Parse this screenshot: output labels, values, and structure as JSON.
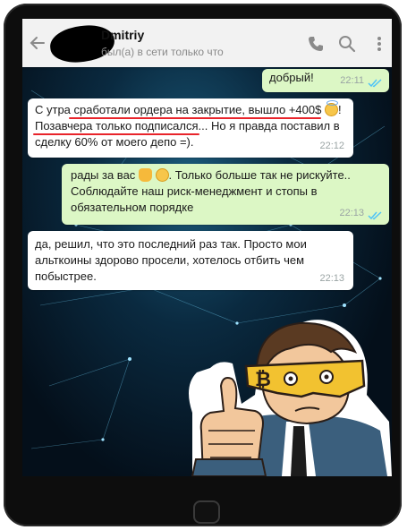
{
  "chat": {
    "contact_name": "Dmitriy",
    "status": "был(а) в сети только что"
  },
  "messages": [
    {
      "direction": "out",
      "text": "добрый!",
      "time": "22:11",
      "read": true
    },
    {
      "direction": "in",
      "text": "С утра сработали ордера на закрытие, вышло +400$ 😇!\nПозавчера только подписался... Но я правда поставил в сделку 60% от моего депо =).",
      "lines": [
        "С утра сработали ордера на закрытие, вышло +400$",
        "! ",
        "Позавчера только подписался... Но я правда поставил в",
        "сделку 60% от моего депо =)."
      ],
      "time": "22:12"
    },
    {
      "direction": "out",
      "lines": [
        "рады за вас",
        ". Только больше так не рискуйте..",
        "Соблюдайте наш риск-менеджмент и стопы в",
        "обязательном порядке"
      ],
      "time": "22:13",
      "read": true
    },
    {
      "direction": "in",
      "lines": [
        "да, решил, что это последний раз так. Просто мои",
        "альткоины здорово просели, хотелось отбить чем",
        "побыстрее."
      ],
      "time": "22:13"
    }
  ],
  "colors": {
    "header_bg": "#f2f2f2",
    "incoming_bubble": "#ffffff",
    "outgoing_bubble": "#dcf7c5",
    "read_ticks": "#4fc3f7",
    "highlight_underline": "#e8242b"
  },
  "icons": [
    "back-arrow-icon",
    "phone-icon",
    "search-icon",
    "more-vertical-icon",
    "double-check-icon",
    "angel-emoji",
    "thumbs-up-emoji",
    "smile-emoji",
    "home-button"
  ]
}
